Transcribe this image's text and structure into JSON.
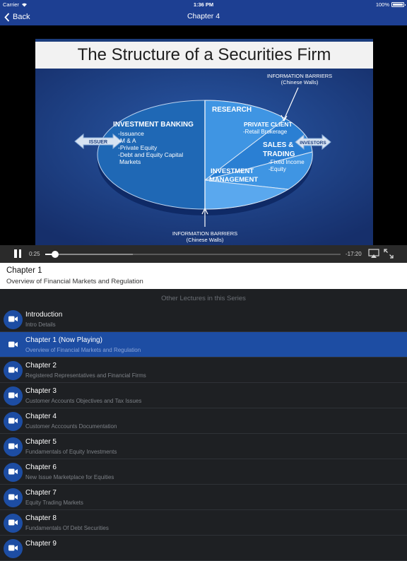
{
  "status": {
    "carrier": "Carrier",
    "time": "1:36 PM",
    "battery": "100%"
  },
  "nav": {
    "back_label": "Back",
    "title": "Chapter 4"
  },
  "slide": {
    "title": "The Structure of a Securities Firm",
    "research": "RESEARCH",
    "info_barriers_top": "INFORMATION BARRIERS",
    "chinese_walls_top": "(Chinese Walls)",
    "investment_banking": "INVESTMENT BANKING",
    "ib_items": [
      "-Issuance",
      "-M & A",
      "-Private Equity",
      "-Debt and Equity Capital",
      "Markets"
    ],
    "issuer": "ISSUER",
    "private_client": "PRIVATE CLIENT",
    "retail_brokerage": "-Retail Brokerage",
    "investors": "INVESTORS",
    "sales_trading_1": "SALES &",
    "sales_trading_2": "TRADING",
    "fixed_income": "-Fixed Income",
    "equity": "-Equity",
    "investment": "INVESTMENT",
    "management": "MANAGEMENT",
    "info_barriers_bottom": "INFORMATION BARRIERS",
    "chinese_walls_bottom": "(Chinese Walls)"
  },
  "player": {
    "elapsed": "0:25",
    "remaining": "-17:20",
    "progress_fraction": 0.024
  },
  "current": {
    "title": "Chapter 1",
    "subtitle": "Overview of Financial Markets and Regulation"
  },
  "list_header": "Other Lectures in this Series",
  "lectures": [
    {
      "title": "Introduction",
      "subtitle": "Intro Details"
    },
    {
      "title": "Chapter 1 (Now Playing)",
      "subtitle": "Overview of Financial Markets and Regulation"
    },
    {
      "title": "Chapter 2",
      "subtitle": "Registered Representatives and Financial Firms"
    },
    {
      "title": "Chapter 3",
      "subtitle": "Customer Accounts Objectives and Tax Issues"
    },
    {
      "title": "Chapter 4",
      "subtitle": "Customer Acccounts Documentation"
    },
    {
      "title": "Chapter 5",
      "subtitle": "Fundamentals of Equity Investments"
    },
    {
      "title": "Chapter 6",
      "subtitle": "New Issue Marketplace for Equities"
    },
    {
      "title": "Chapter 7",
      "subtitle": "Equity Trading Markets"
    },
    {
      "title": "Chapter 8",
      "subtitle": "Fundamentals Of Debt Securities"
    },
    {
      "title": "Chapter 9",
      "subtitle": ""
    }
  ]
}
